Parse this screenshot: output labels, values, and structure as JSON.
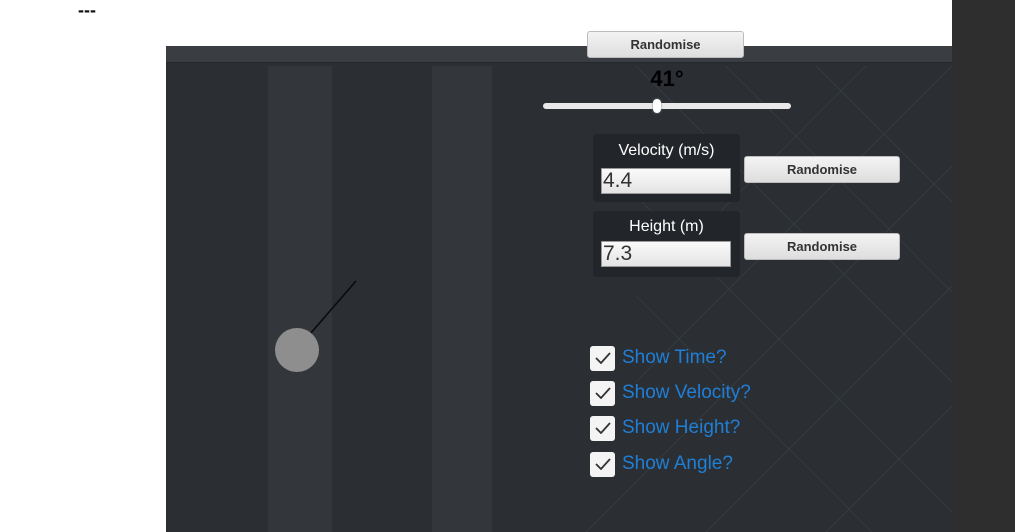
{
  "header": {
    "dashes": "---"
  },
  "controls": {
    "top_randomise_label": "Randomise",
    "angle_text": "41°",
    "angle_slider_fraction": 0.46
  },
  "velocity": {
    "title": "Velocity (m/s)",
    "value": "4.4",
    "randomise_label": "Randomise"
  },
  "height": {
    "title": "Height (m)",
    "value": "7.3",
    "randomise_label": "Randomise"
  },
  "toggles": [
    {
      "label": "Show Time?",
      "checked": true
    },
    {
      "label": "Show Velocity?",
      "checked": true
    },
    {
      "label": "Show Height?",
      "checked": true
    },
    {
      "label": "Show Angle?",
      "checked": true
    }
  ],
  "colors": {
    "sim_background": "#2b2f34",
    "toggle_text": "#1f7fd6",
    "ball": "#8e8e8e"
  }
}
